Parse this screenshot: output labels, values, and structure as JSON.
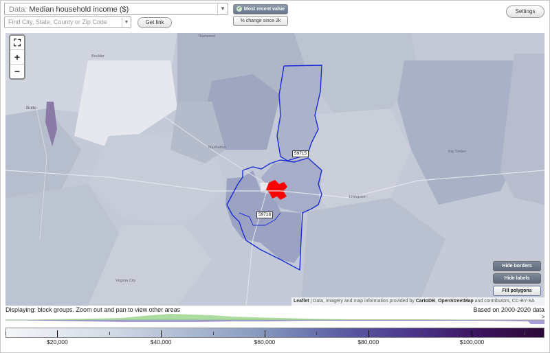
{
  "header": {
    "data_prefix": "Data:",
    "data_value": "Median household income ($)",
    "search_placeholder": "Find City, State, County or Zip Code",
    "get_link_label": "Get link",
    "most_recent_label": "Most recent value",
    "change_label": "% change since 2k",
    "settings_label": "Settings"
  },
  "map": {
    "zoom_in": "+",
    "zoom_out": "−",
    "zip_labels": [
      "59715",
      "59718"
    ],
    "places": [
      "Townsend",
      "Boulder",
      "Butte",
      "Manhattan",
      "Livingston",
      "Big Timber",
      "Virginia City"
    ],
    "buttons": {
      "hide_borders": "Hide borders",
      "hide_labels": "Hide labels",
      "fill_polygons": "Fill polygons"
    },
    "attribution_leaflet": "Leaflet",
    "attribution_text": " | Data, imagery and map information provided by ",
    "attribution_carto": "CartoDB",
    "attribution_osm": "OpenStreetMap",
    "attribution_tail": " and contributors, CC-BY-SA",
    "colors": {
      "highlight": "#ff0000",
      "boundary": "#1a2bd6"
    }
  },
  "status": {
    "displaying": "Displaying: block groups. Zoom out and pan to view other areas",
    "based_on": "Based on 2000-2020 data"
  },
  "legend": {
    "labels": [
      "$20,000",
      "$40,000",
      "$60,000",
      "$80,000",
      "$100,000"
    ],
    "min": 10000,
    "max": 114000,
    "values": [
      20000,
      40000,
      60000,
      80000,
      100000
    ],
    "greater_than_marker": ">"
  }
}
